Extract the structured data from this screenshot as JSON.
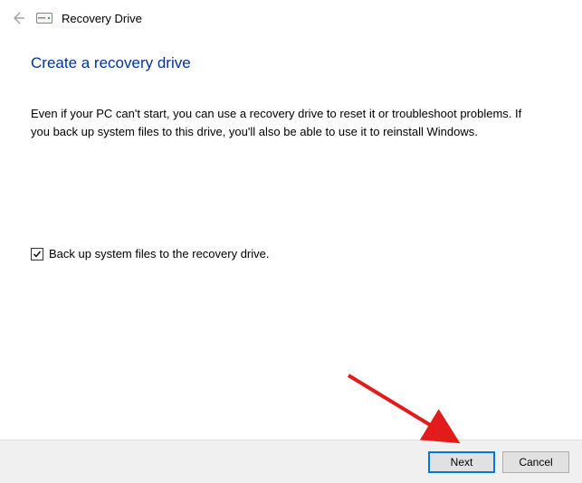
{
  "header": {
    "window_title": "Recovery Drive"
  },
  "main": {
    "heading": "Create a recovery drive",
    "description": "Even if your PC can't start, you can use a recovery drive to reset it or troubleshoot problems. If you back up system files to this drive, you'll also be able to use it to reinstall Windows.",
    "checkbox": {
      "label": "Back up system files to the recovery drive.",
      "checked": true
    }
  },
  "footer": {
    "next_label": "Next",
    "cancel_label": "Cancel"
  }
}
